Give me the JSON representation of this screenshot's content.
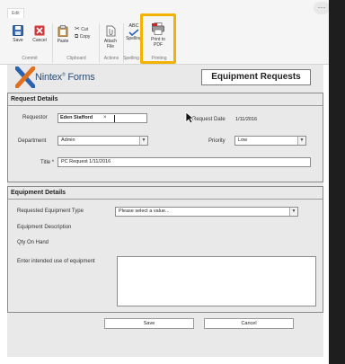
{
  "ribbon": {
    "tab_label": "Edit",
    "commit": {
      "save": "Save",
      "cancel": "Cancel",
      "group": "Commit"
    },
    "clipboard": {
      "paste": "Paste",
      "cut": "Cut",
      "copy": "Copy",
      "group": "Clipboard"
    },
    "actions": {
      "attach_line1": "Attach",
      "attach_line2": "File",
      "group": "Actions"
    },
    "spelling": {
      "label": "Spelling",
      "abc": "ABC",
      "group": "Spelling"
    },
    "printing": {
      "line1": "Print to",
      "line2": "PDF",
      "group": "Printing"
    }
  },
  "header": {
    "brand": "Nintex",
    "brand_suffix": "Forms",
    "registered": "®",
    "form_title": "Equipment Requests"
  },
  "request_details": {
    "title": "Request Details",
    "requestor_label": "Requestor",
    "requestor_value": "Eden Stafford",
    "requestor_remove": "×",
    "request_date_label": "Request Date",
    "request_date_value": "1/11/2016",
    "department_label": "Department",
    "department_value": "Admin",
    "priority_label": "Priority",
    "priority_value": "Low",
    "title_label": "Title *",
    "title_value": "PC Request 1/11/2016"
  },
  "equipment_details": {
    "title": "Equipment Details",
    "type_label": "Requested Equipment Type",
    "type_placeholder": "Please select a value...",
    "description_label": "Equipment Description",
    "qty_label": "Qty On Hand",
    "use_label": "Enter intended use of equipment"
  },
  "actions": {
    "save": "Save",
    "cancel": "Cancel"
  },
  "more_menu": "···",
  "colors": {
    "highlight": "#f2b200",
    "brand_blue": "#2c4e7a",
    "logo_orange": "#e0701d",
    "logo_blue": "#2a62b0"
  }
}
